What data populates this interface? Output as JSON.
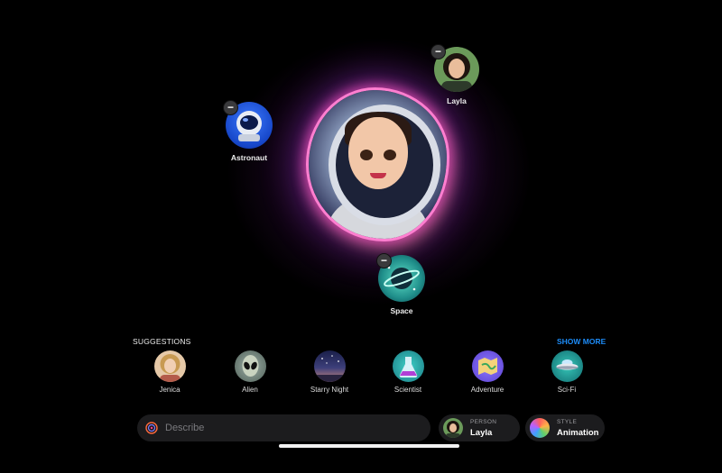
{
  "selected": {
    "person": {
      "name": "Layla"
    },
    "items": [
      {
        "label": "Astronaut",
        "icon": "astronaut-helmet-icon",
        "remove": "−"
      },
      {
        "label": "Space",
        "icon": "planet-icon",
        "remove": "−"
      }
    ],
    "person_remove": "−"
  },
  "suggestions": {
    "header": "SUGGESTIONS",
    "show_more": "SHOW MORE",
    "items": [
      {
        "label": "Jenica",
        "icon": "person-avatar"
      },
      {
        "label": "Alien",
        "icon": "alien-icon"
      },
      {
        "label": "Starry Night",
        "icon": "starry-night-icon"
      },
      {
        "label": "Scientist",
        "icon": "flask-icon"
      },
      {
        "label": "Adventure",
        "icon": "map-icon"
      },
      {
        "label": "Sci-Fi",
        "icon": "ufo-icon"
      }
    ]
  },
  "composer": {
    "placeholder": "Describe",
    "person": {
      "caption": "PERSON",
      "value": "Layla"
    },
    "style": {
      "caption": "STYLE",
      "value": "Animation"
    }
  },
  "colors": {
    "accent": "#1d8cf8",
    "glow": "#ff7fd0"
  }
}
